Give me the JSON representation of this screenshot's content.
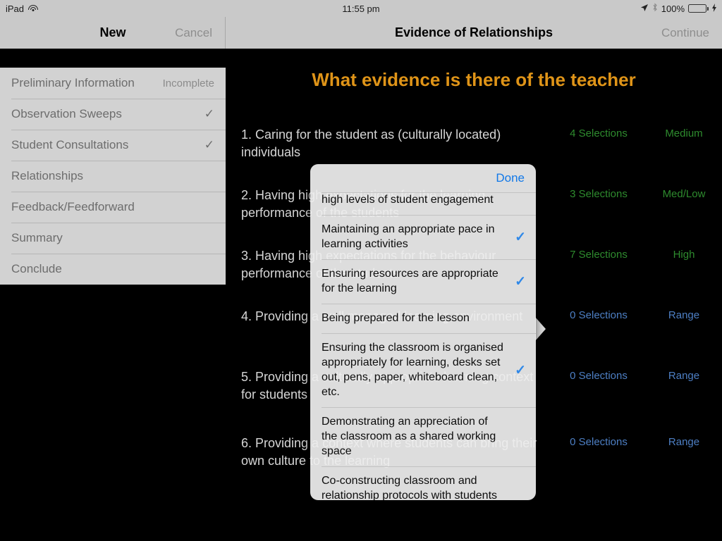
{
  "statusbar": {
    "device": "iPad",
    "wifi_icon": "wifi-icon",
    "time": "11:55 pm",
    "location_icon": "location-arrow-icon",
    "bluetooth_icon": "bluetooth-icon",
    "battery_percent": "100%",
    "battery_icon": "battery-full-icon",
    "charging_icon": "lightning-bolt-icon"
  },
  "left_nav": {
    "title": "New",
    "cancel_label": "Cancel"
  },
  "right_nav": {
    "title": "Evidence of Relationships",
    "continue_label": "Continue"
  },
  "sidebar": {
    "items": [
      {
        "label": "Preliminary Information",
        "status": "Incomplete",
        "checked": false
      },
      {
        "label": "Observation Sweeps",
        "status": "",
        "checked": true
      },
      {
        "label": "Student Consultations",
        "status": "",
        "checked": true
      },
      {
        "label": "Relationships",
        "status": "",
        "checked": false
      },
      {
        "label": "Feedback/Feedforward",
        "status": "",
        "checked": false
      },
      {
        "label": "Summary",
        "status": "",
        "checked": false
      },
      {
        "label": "Conclude",
        "status": "",
        "checked": false
      }
    ],
    "check_glyph": "✓"
  },
  "main": {
    "title": "What evidence is there of the teacher",
    "title_color": "#df9418",
    "green": "#2e8b2e",
    "blue": "#4d7fc4",
    "rows": [
      {
        "text": "1. Caring for the student as (culturally located) individuals",
        "selections": "4 Selections",
        "rating": "Medium",
        "color": "green"
      },
      {
        "text": "2. Having high expectations for the learning performance of the students",
        "selections": "3 Selections",
        "rating": "Med/Low",
        "color": "green"
      },
      {
        "text": "3. Having high expectations for the behaviour performance of the students",
        "selections": "7 Selections",
        "rating": "High",
        "color": "green"
      },
      {
        "text": "4. Providing a well managed learning environment",
        "selections": "0 Selections",
        "rating": "Range",
        "color": "blue"
      },
      {
        "text": "5. Providing a culturally appropriate learning context for students",
        "selections": "0 Selections",
        "rating": "Range",
        "color": "blue"
      },
      {
        "text": "6. Providing a context where students can bring their own culture to the learning",
        "selections": "0 Selections",
        "rating": "Range",
        "color": "blue"
      }
    ]
  },
  "popover": {
    "done_label": "Done",
    "check_glyph": "✓",
    "items": [
      {
        "text": "high levels of student engagement",
        "checked": false,
        "clipped": true
      },
      {
        "text": "Maintaining an appropriate pace in learning activities",
        "checked": true,
        "clipped": false
      },
      {
        "text": "Ensuring resources are appropriate for the learning",
        "checked": true,
        "clipped": false
      },
      {
        "text": "Being prepared for the lesson",
        "checked": false,
        "clipped": false
      },
      {
        "text": "Ensuring the classroom is organised appropriately for learning, desks set out, pens, paper, whiteboard clean, etc.",
        "checked": true,
        "clipped": false
      },
      {
        "text": "Demonstrating an appreciation of the classroom as a shared working space",
        "checked": false,
        "clipped": false
      },
      {
        "text": "Co-constructing classroom and relationship protocols with students",
        "checked": false,
        "clipped": false
      }
    ]
  }
}
